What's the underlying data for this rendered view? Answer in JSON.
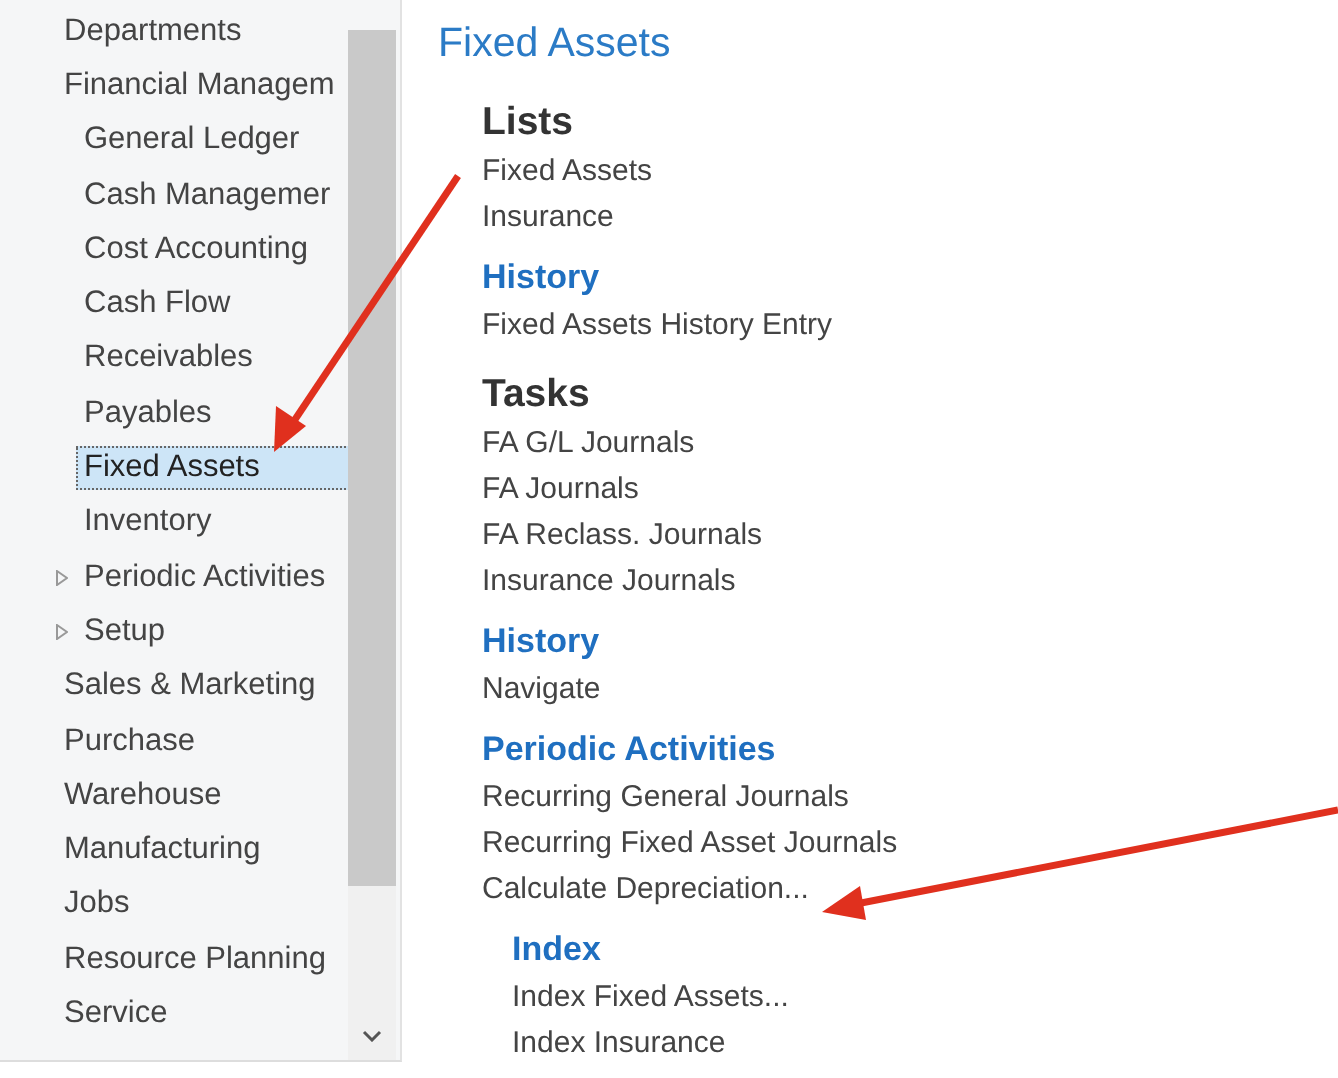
{
  "sidebar": {
    "items": [
      {
        "label": "Departments",
        "selected": false
      },
      {
        "label": "Financial Managem",
        "selected": false,
        "children": [
          {
            "label": "General Ledger",
            "selected": false
          },
          {
            "label": "Cash Managemer",
            "selected": false
          },
          {
            "label": "Cost Accounting",
            "selected": false
          },
          {
            "label": "Cash Flow",
            "selected": false
          },
          {
            "label": "Receivables",
            "selected": false
          },
          {
            "label": "Payables",
            "selected": false
          },
          {
            "label": "Fixed Assets",
            "selected": true
          },
          {
            "label": "Inventory",
            "selected": false
          },
          {
            "label": "Periodic Activities",
            "selected": false,
            "expanded": false
          },
          {
            "label": "Setup",
            "selected": false,
            "expanded": false
          }
        ]
      },
      {
        "label": "Sales & Marketing",
        "selected": false
      },
      {
        "label": "Purchase",
        "selected": false
      },
      {
        "label": "Warehouse",
        "selected": false
      },
      {
        "label": "Manufacturing",
        "selected": false
      },
      {
        "label": "Jobs",
        "selected": false
      },
      {
        "label": "Resource Planning",
        "selected": false
      },
      {
        "label": "Service",
        "selected": false
      }
    ]
  },
  "page": {
    "title": "Fixed Assets",
    "sections": [
      {
        "heading": "Lists",
        "kind": "group",
        "items": [
          "Fixed Assets",
          "Insurance"
        ]
      },
      {
        "heading": "History",
        "kind": "sub",
        "items": [
          "Fixed Assets History Entry"
        ]
      },
      {
        "heading": "Tasks",
        "kind": "group",
        "items": [
          "FA G/L Journals",
          "FA Journals",
          "FA Reclass. Journals",
          "Insurance Journals"
        ]
      },
      {
        "heading": "History",
        "kind": "sub",
        "items": [
          "Navigate"
        ]
      },
      {
        "heading": "Periodic Activities",
        "kind": "sub",
        "items": [
          "Recurring General Journals",
          "Recurring Fixed Asset Journals",
          "Calculate Depreciation..."
        ],
        "children": [
          {
            "heading": "Index",
            "kind": "sub",
            "items": [
              "Index Fixed Assets...",
              "Index Insurance"
            ]
          }
        ]
      }
    ]
  }
}
